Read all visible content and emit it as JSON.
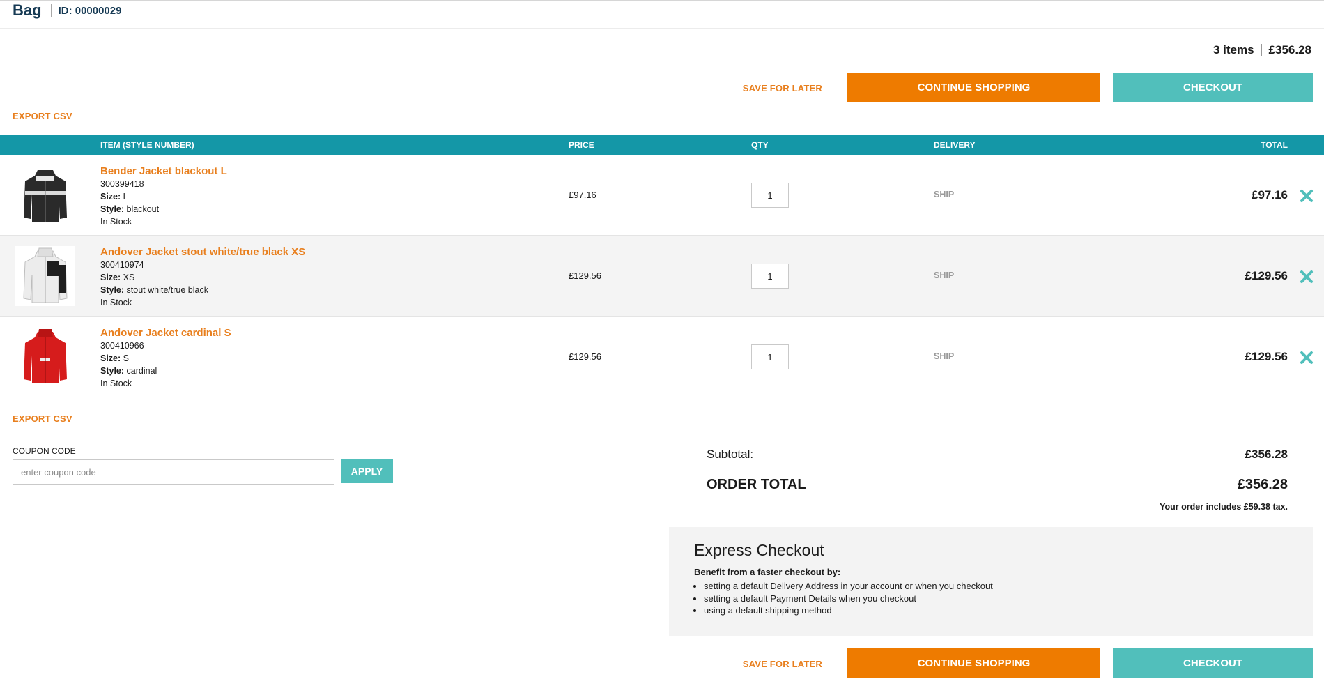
{
  "header": {
    "title": "Bag",
    "order_id": "ID: 00000029"
  },
  "summary": {
    "items_count": "3 items",
    "total": "£356.28"
  },
  "actions": {
    "save_for_later": "SAVE FOR LATER",
    "continue_shopping": "CONTINUE SHOPPING",
    "checkout": "CHECKOUT"
  },
  "export_csv": "EXPORT CSV",
  "table": {
    "columns": {
      "item": "ITEM (STYLE NUMBER)",
      "price": "PRICE",
      "qty": "QTY",
      "delivery": "DELIVERY",
      "total": "TOTAL"
    },
    "rows": [
      {
        "name": "Bender Jacket blackout L",
        "style_number": "300399418",
        "size_label": "Size:",
        "size": "L",
        "style_label": "Style:",
        "style": "blackout",
        "stock": "In Stock",
        "price": "£97.16",
        "qty": "1",
        "delivery": "SHIP",
        "total": "£97.16",
        "thumb_icon": "black-jacket-image"
      },
      {
        "name": "Andover Jacket stout white/true black XS",
        "style_number": "300410974",
        "size_label": "Size:",
        "size": "XS",
        "style_label": "Style:",
        "style": "stout white/true black",
        "stock": "In Stock",
        "price": "£129.56",
        "qty": "1",
        "delivery": "SHIP",
        "total": "£129.56",
        "thumb_icon": "white-jacket-image"
      },
      {
        "name": "Andover Jacket cardinal S",
        "style_number": "300410966",
        "size_label": "Size:",
        "size": "S",
        "style_label": "Style:",
        "style": "cardinal",
        "stock": "In Stock",
        "price": "£129.56",
        "qty": "1",
        "delivery": "SHIP",
        "total": "£129.56",
        "thumb_icon": "red-jacket-image"
      }
    ]
  },
  "coupon": {
    "label": "COUPON CODE",
    "placeholder": "enter coupon code",
    "apply": "APPLY"
  },
  "totals": {
    "subtotal_label": "Subtotal:",
    "subtotal": "£356.28",
    "order_total_label": "ORDER TOTAL",
    "order_total": "£356.28",
    "tax_note": "Your order includes £59.38 tax."
  },
  "express": {
    "title": "Express Checkout",
    "subtitle": "Benefit from a faster checkout by:",
    "items": [
      "setting a default Delivery Address in your account or when you checkout",
      "setting a default Payment Details when you checkout",
      "using a default shipping method"
    ]
  },
  "colors": {
    "orange": "#ee7b00",
    "orange_text": "#e87f1e",
    "teal": "#51bfbb",
    "table_header": "#1497a7",
    "title": "#163a54"
  }
}
